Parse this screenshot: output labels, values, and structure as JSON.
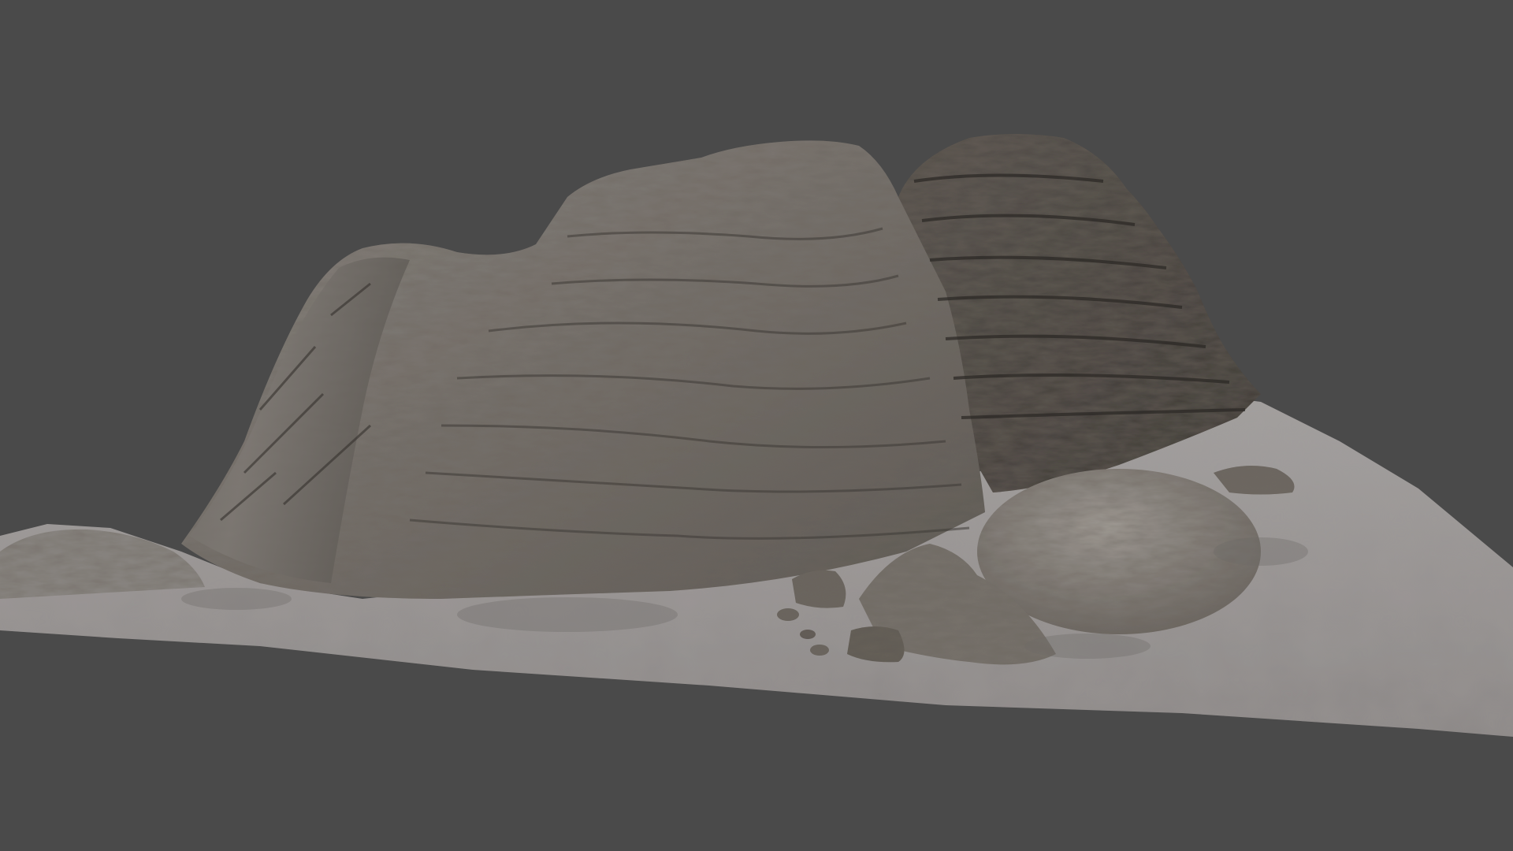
{
  "viewport": {
    "background_color": "#4a4a4a"
  },
  "scene": {
    "subject": "rock-formation-3d-model",
    "ground_color": "#9b9898",
    "rock_color_light": "#8a8580",
    "rock_color_mid": "#6e6a65",
    "rock_color_dark": "#3f3b37"
  }
}
